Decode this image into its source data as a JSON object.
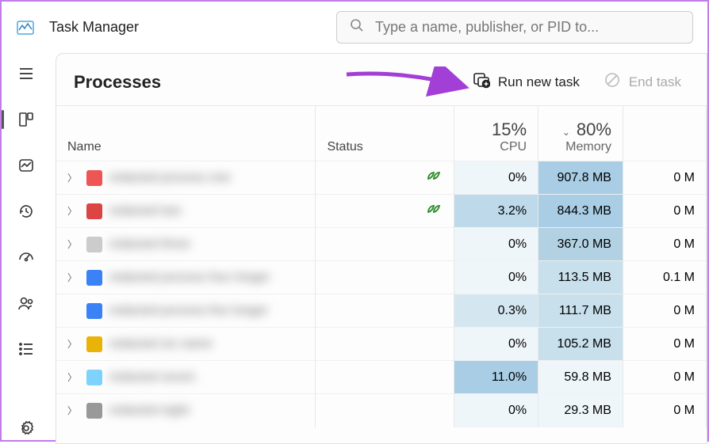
{
  "app_title": "Task Manager",
  "search": {
    "placeholder": "Type a name, publisher, or PID to..."
  },
  "page_title": "Processes",
  "actions": {
    "run_new_task": "Run new task",
    "end_task": "End task"
  },
  "columns": {
    "name": "Name",
    "status": "Status",
    "cpu": {
      "pct": "15%",
      "label": "CPU"
    },
    "memory": {
      "pct": "80%",
      "label": "Memory"
    }
  },
  "rows": [
    {
      "expand": true,
      "icon": "#e55",
      "name": "redacted process one",
      "leaf": true,
      "cpu": "0%",
      "cpu_lvl": 0,
      "mem": "907.8 MB",
      "mem_lvl": 3,
      "disk": "0 M"
    },
    {
      "expand": true,
      "icon": "#d44",
      "name": "redacted two",
      "leaf": true,
      "cpu": "3.2%",
      "cpu_lvl": 2,
      "mem": "844.3 MB",
      "mem_lvl": 3,
      "disk": "0 M"
    },
    {
      "expand": true,
      "icon": "#ccc",
      "name": "redacted three",
      "leaf": false,
      "cpu": "0%",
      "cpu_lvl": 0,
      "mem": "367.0 MB",
      "mem_lvl": 2,
      "disk": "0 M"
    },
    {
      "expand": true,
      "icon": "#3b82f6",
      "name": "redacted process four longer",
      "leaf": false,
      "cpu": "0%",
      "cpu_lvl": 0,
      "mem": "113.5 MB",
      "mem_lvl": 1,
      "disk": "0.1 M"
    },
    {
      "expand": false,
      "icon": "#3b82f6",
      "name": "redacted process five longer",
      "leaf": false,
      "cpu": "0.3%",
      "cpu_lvl": 1,
      "mem": "111.7 MB",
      "mem_lvl": 1,
      "disk": "0 M"
    },
    {
      "expand": true,
      "icon": "#eab308",
      "name": "redacted six name",
      "leaf": false,
      "cpu": "0%",
      "cpu_lvl": 0,
      "mem": "105.2 MB",
      "mem_lvl": 1,
      "disk": "0 M"
    },
    {
      "expand": true,
      "icon": "#7dd3fc",
      "name": "redacted seven",
      "leaf": false,
      "cpu": "11.0%",
      "cpu_lvl": 3,
      "mem": "59.8 MB",
      "mem_lvl": 0,
      "disk": "0 M"
    },
    {
      "expand": true,
      "icon": "#999",
      "name": "redacted eight",
      "leaf": false,
      "cpu": "0%",
      "cpu_lvl": 0,
      "mem": "29.3 MB",
      "mem_lvl": 0,
      "disk": "0 M"
    }
  ]
}
